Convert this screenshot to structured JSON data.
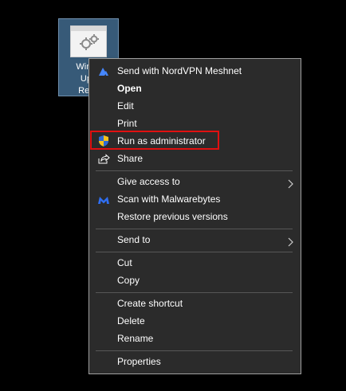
{
  "desktop_icon": {
    "label_lines": [
      "Windo",
      "Upd",
      "Rese"
    ]
  },
  "context_menu": {
    "items": [
      {
        "label": "Send with NordVPN Meshnet",
        "icon": "nordvpn-icon"
      },
      {
        "label": "Open"
      },
      {
        "label": "Edit"
      },
      {
        "label": "Print"
      },
      {
        "label": "Run as administrator",
        "icon": "uac-shield-icon"
      },
      {
        "label": "Share",
        "icon": "share-icon"
      },
      {
        "label": "Give access to",
        "submenu": true
      },
      {
        "label": "Scan with Malwarebytes",
        "icon": "malwarebytes-icon"
      },
      {
        "label": "Restore previous versions"
      },
      {
        "label": "Send to",
        "submenu": true
      },
      {
        "label": "Cut"
      },
      {
        "label": "Copy"
      },
      {
        "label": "Create shortcut"
      },
      {
        "label": "Delete"
      },
      {
        "label": "Rename"
      },
      {
        "label": "Properties"
      }
    ]
  },
  "colors": {
    "menu_background": "#2b2b2b",
    "highlight_border": "#e01010",
    "desktop_background": "#000000"
  }
}
